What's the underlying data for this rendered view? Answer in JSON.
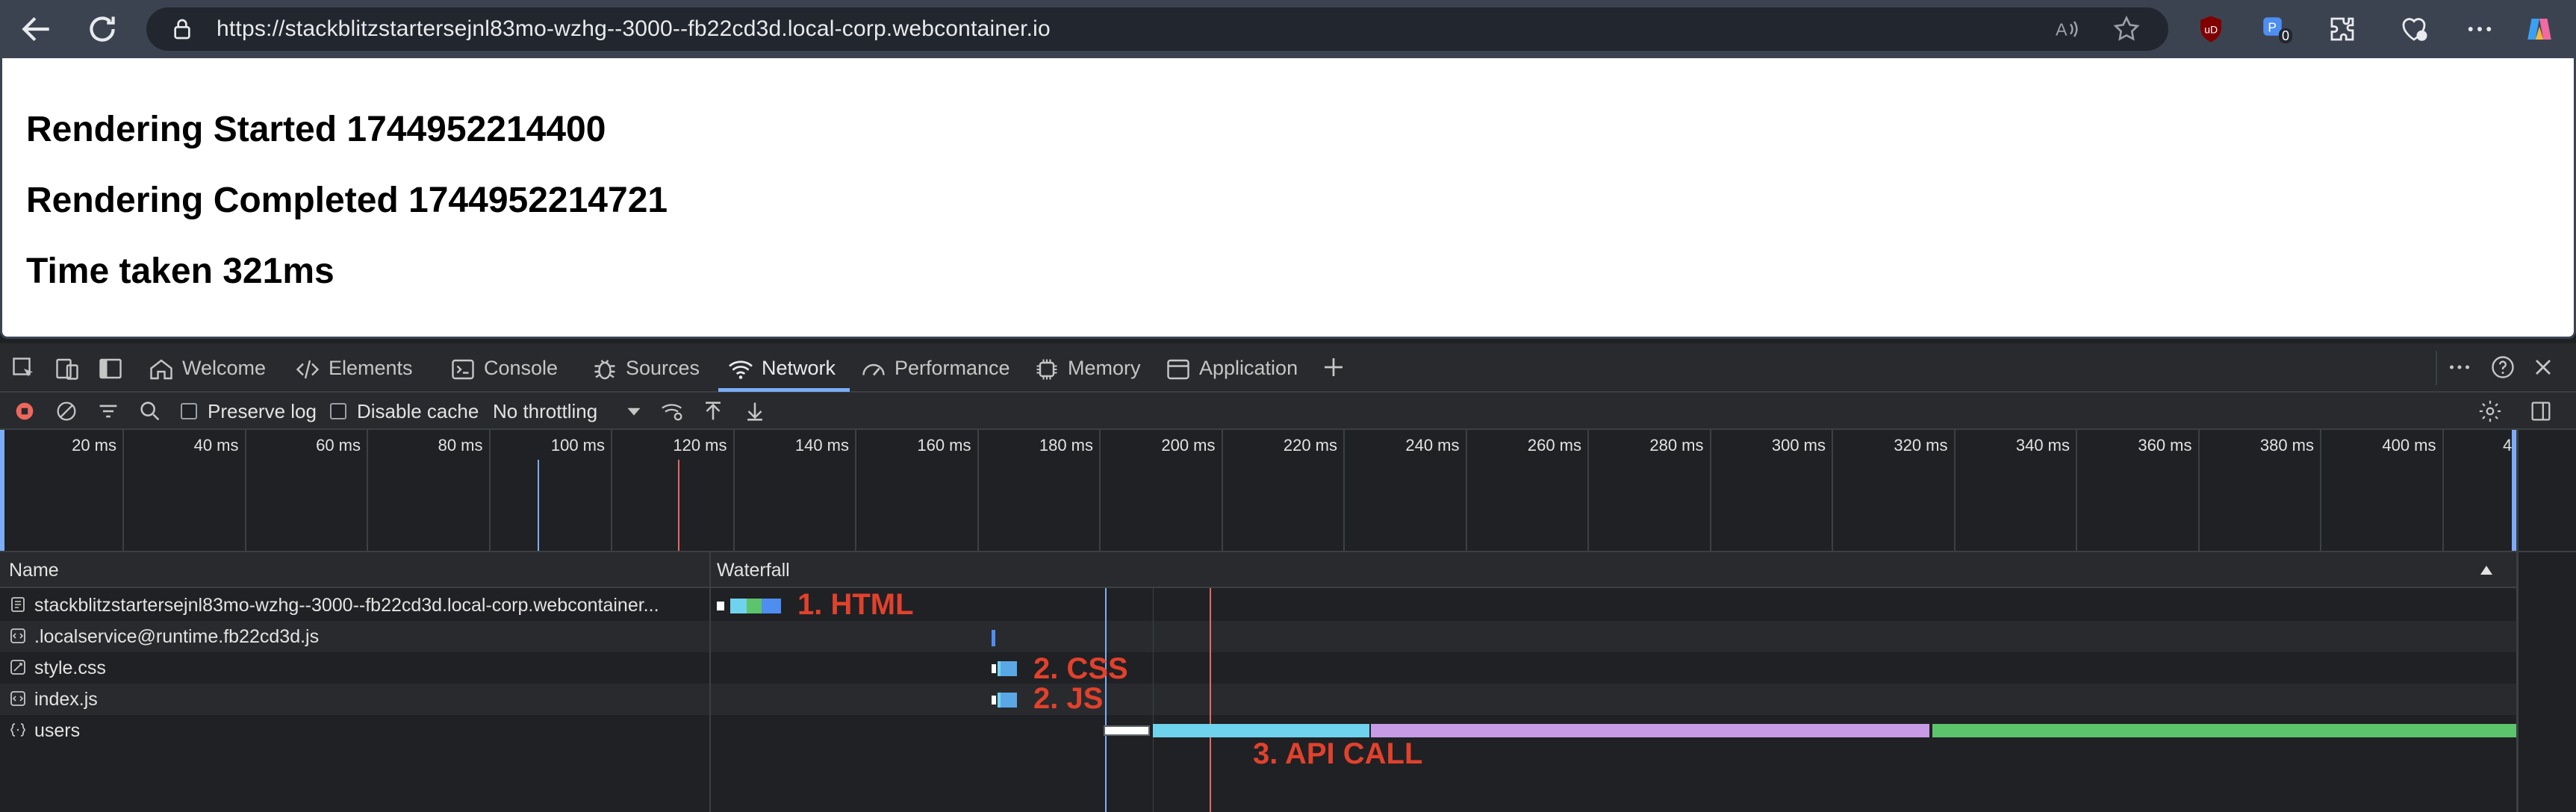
{
  "browser": {
    "url": "https://stackblitzstartersejnl83mo-wzhg--3000--fb22cd3d.local-corp.webcontainer.io",
    "extension_badge": "0"
  },
  "page": {
    "headings": [
      "Rendering Started 1744952214400",
      "Rendering Completed 1744952214721",
      "Time taken 321ms"
    ]
  },
  "devtools": {
    "tabs": [
      {
        "label": "Welcome",
        "icon": "home-icon"
      },
      {
        "label": "Elements",
        "icon": "code-icon"
      },
      {
        "label": "Console",
        "icon": "console-icon"
      },
      {
        "label": "Sources",
        "icon": "bug-icon"
      },
      {
        "label": "Network",
        "icon": "wifi-icon",
        "active": true
      },
      {
        "label": "Performance",
        "icon": "gauge-icon"
      },
      {
        "label": "Memory",
        "icon": "chip-icon"
      },
      {
        "label": "Application",
        "icon": "window-icon"
      }
    ],
    "toolbar": {
      "preserve_log": "Preserve log",
      "disable_cache": "Disable cache",
      "throttling": "No throttling"
    },
    "overview_ticks": [
      "20 ms",
      "40 ms",
      "60 ms",
      "80 ms",
      "100 ms",
      "120 ms",
      "140 ms",
      "160 ms",
      "180 ms",
      "200 ms",
      "220 ms",
      "240 ms",
      "260 ms",
      "280 ms",
      "300 ms",
      "320 ms",
      "340 ms",
      "360 ms",
      "380 ms",
      "400 ms",
      "4"
    ],
    "table": {
      "col_name": "Name",
      "col_waterfall": "Waterfall",
      "rows": [
        {
          "name": "stackblitzstartersejnl83mo-wzhg--3000--fb22cd3d.local-corp.webcontainer...",
          "icon": "document-icon"
        },
        {
          "name": ".localservice@runtime.fb22cd3d.js",
          "icon": "script-icon"
        },
        {
          "name": "style.css",
          "icon": "stylesheet-icon"
        },
        {
          "name": "index.js",
          "icon": "script-icon"
        },
        {
          "name": "users",
          "icon": "fetch-icon"
        }
      ]
    },
    "annotations": {
      "html": "1. HTML",
      "css": "2. CSS",
      "js": "2. JS",
      "api": "3. API CALL"
    },
    "colors": {
      "accent": "#7cacf8",
      "waiting": "#6fd3ee",
      "download": "#5aa7e6",
      "ttfb": "#c79be6",
      "content": "#5cc46b",
      "annotation": "#e2412c"
    }
  }
}
